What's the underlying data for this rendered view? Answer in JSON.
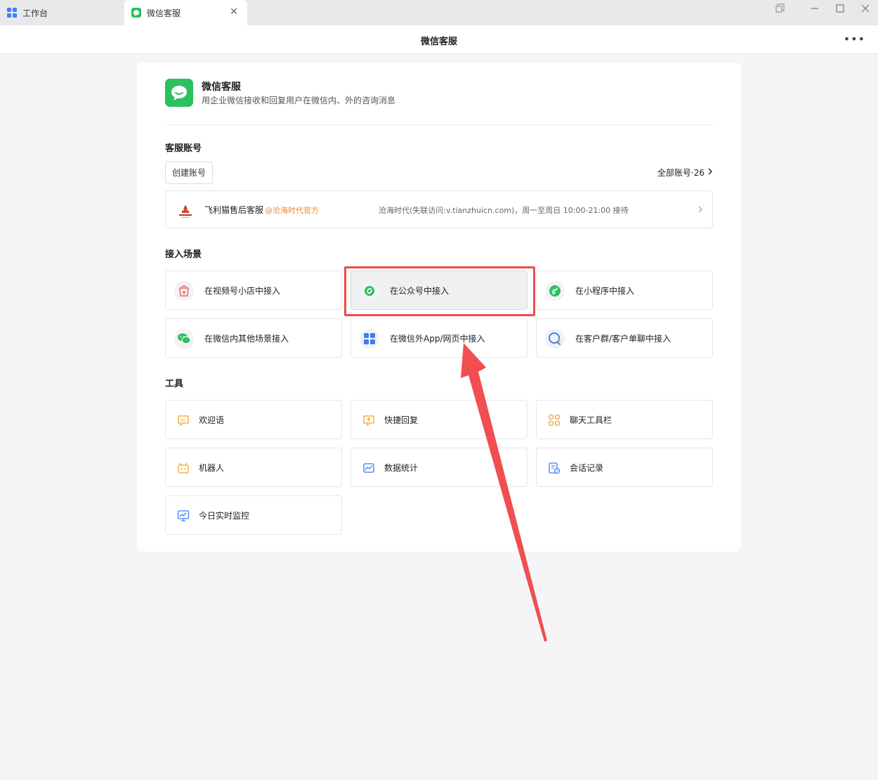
{
  "tabs": {
    "workbench": "工作台",
    "wechat_service": "微信客服"
  },
  "titlebar": {
    "title": "微信客服",
    "more": "•••"
  },
  "app": {
    "name": "微信客服",
    "description": "用企业微信接收和回复用户在微信内、外的咨询消息",
    "brand_color": "#2dc05f"
  },
  "accounts": {
    "section_title": "客服账号",
    "create_label": "创建账号",
    "all_label": "全部账号·26",
    "row": {
      "name": "飞利猫售后客服",
      "tag": "@沧海时代官方",
      "info": "沧海时代(失联访问:v.tianzhuicn.com)，周一至周日 10:00-21:00 接待"
    }
  },
  "scenes": {
    "section_title": "接入场景",
    "items": [
      {
        "label": "在视频号小店中接入",
        "icon": "video-shop-icon",
        "color": "#f0675e"
      },
      {
        "label": "在公众号中接入",
        "icon": "official-account-icon",
        "color": "#2dc05f"
      },
      {
        "label": "在小程序中接入",
        "icon": "mini-program-icon",
        "color": "#2dc05f"
      },
      {
        "label": "在微信内其他场景接入",
        "icon": "wechat-icon",
        "color": "#2dc05f"
      },
      {
        "label": "在微信外App/网页中接入",
        "icon": "app-grid-icon",
        "color": "#3d7ef7"
      },
      {
        "label": "在客户群/客户单聊中接入",
        "icon": "customer-chat-icon",
        "color": "#3d7ef7"
      }
    ]
  },
  "tools": {
    "section_title": "工具",
    "items": [
      {
        "label": "欢迎语",
        "icon": "hi-icon",
        "color": "#f2a531"
      },
      {
        "label": "快捷回复",
        "icon": "quick-reply-icon",
        "color": "#f2a531"
      },
      {
        "label": "聊天工具栏",
        "icon": "toolbar-icon",
        "color": "#f2a531"
      },
      {
        "label": "机器人",
        "icon": "robot-icon",
        "color": "#f2a531"
      },
      {
        "label": "数据统计",
        "icon": "stats-icon",
        "color": "#3d7ef7"
      },
      {
        "label": "会话记录",
        "icon": "record-icon",
        "color": "#3d7ef7"
      },
      {
        "label": "今日实时监控",
        "icon": "monitor-icon",
        "color": "#3d7ef7"
      }
    ]
  },
  "annotation": {
    "color": "#ef4b4b"
  }
}
